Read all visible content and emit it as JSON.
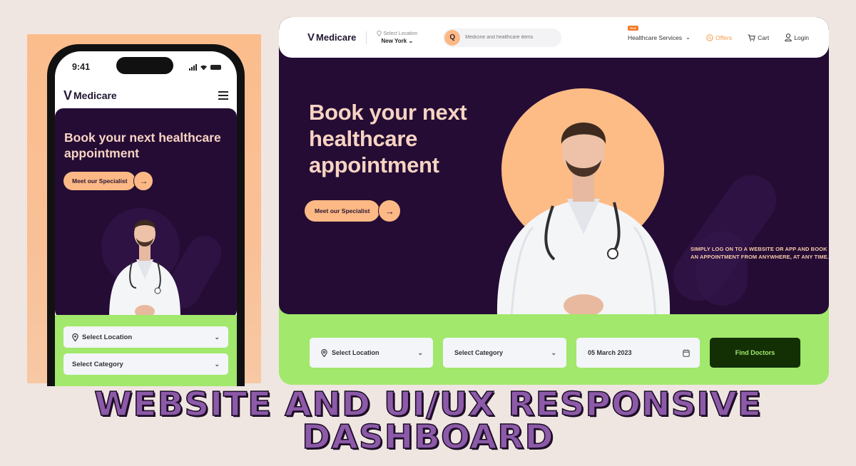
{
  "brand": {
    "name": "Medicare",
    "colors": {
      "hero_bg": "#240c35",
      "accent_peach": "#fcb985",
      "form_green": "#a1e86c",
      "cta_dark_green": "#133005",
      "headline_pink": "#f7d3c2",
      "offers_orange": "#f39a45",
      "banner_purple": "#8c5aa8"
    }
  },
  "mobile": {
    "status_bar": {
      "time": "9:41",
      "icons": [
        "signal-icon",
        "wifi-icon",
        "battery-icon"
      ]
    },
    "nav": {
      "logo": "Medicare",
      "menu_icon": "hamburger-icon"
    },
    "hero": {
      "headline": "Book your next healthcare appointment",
      "cta_label": "Meet our Specialist",
      "cta_arrow": "→"
    },
    "form": {
      "location": {
        "label": "Select Location",
        "icon": "map-pin-icon"
      },
      "category": {
        "label": "Select Category"
      }
    }
  },
  "desktop": {
    "nav": {
      "logo": "Medicare",
      "location_label": "Select Location",
      "location_value": "New York",
      "search_placeholder": "Medicine and healthcare items",
      "services_badge": "New",
      "services_label": "Healthcare Services",
      "offers_label": "Offers",
      "cart_label": "Cart",
      "login_label": "Login"
    },
    "hero": {
      "headline_lines": [
        "Book your next",
        "healthcare",
        "appointment"
      ],
      "cta_label": "Meet our Specialist",
      "cta_arrow": "→",
      "tagline": "SIMPLY LOG ON TO A WEBSITE OR APP AND BOOK AN APPOINTMENT FROM ANYWHERE, AT ANY TIME."
    },
    "form": {
      "location": {
        "label": "Select Location",
        "icon": "map-pin-icon"
      },
      "category": {
        "label": "Select Category"
      },
      "date": {
        "value": "05 March 2023",
        "icon": "calendar-icon"
      },
      "submit_label": "Find Doctors"
    }
  },
  "banner": {
    "line1": "WEBSITE AND UI/UX RESPONSIVE",
    "line2": "DASHBOARD"
  }
}
